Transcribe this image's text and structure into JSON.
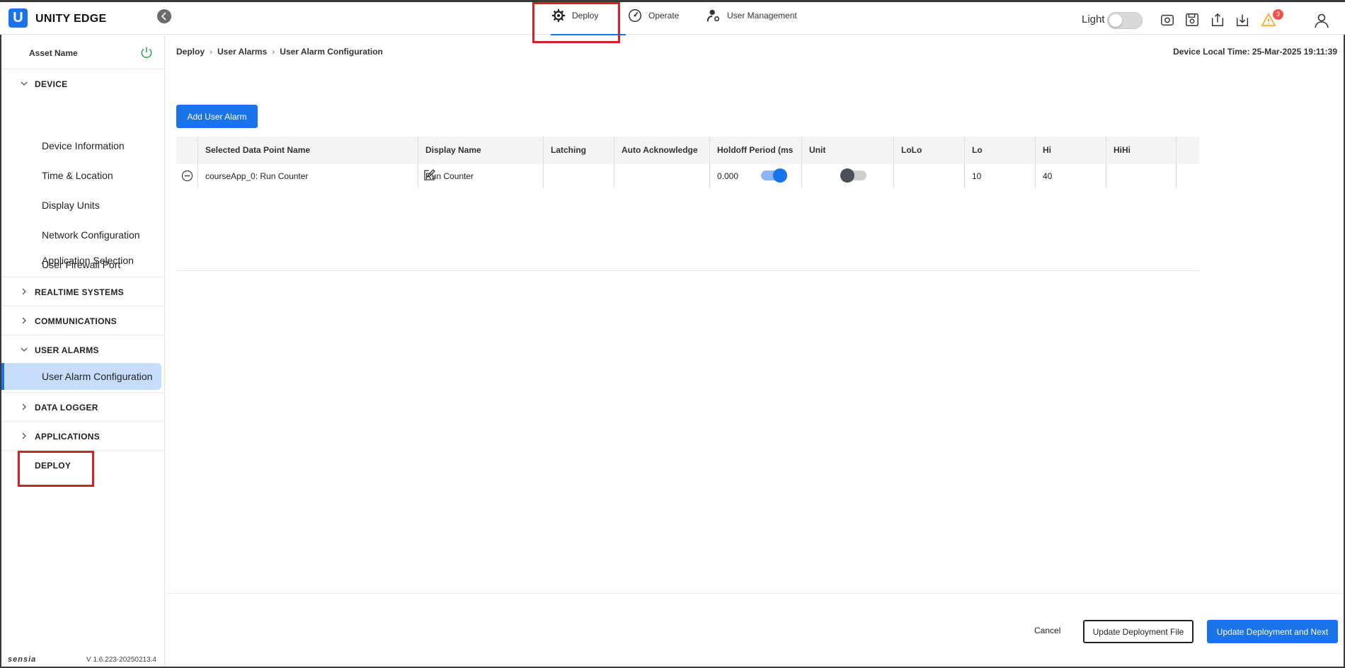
{
  "header": {
    "logo_letter": "U",
    "brand": "UNITY EDGE",
    "tabs": [
      {
        "label": "Deploy",
        "icon": "deploy-gear-icon",
        "active": true
      },
      {
        "label": "Operate",
        "icon": "gauge-icon",
        "active": false
      },
      {
        "label": "User Management",
        "icon": "user-gear-icon",
        "active": false
      }
    ],
    "theme_label": "Light",
    "alert_count": "3",
    "icons": [
      "settings-disk-icon",
      "save-icon",
      "upload-icon",
      "download-icon",
      "warning-icon",
      "user-avatar-icon"
    ]
  },
  "sidebar": {
    "asset_name": "Asset Name",
    "sections": [
      {
        "label": "DEVICE",
        "expanded": true,
        "items": [
          "Device Information",
          "Time & Location",
          "Display Units",
          "Network Configuration",
          "User Firewall Port",
          "Application Selection"
        ]
      },
      {
        "label": "REALTIME SYSTEMS",
        "expanded": false
      },
      {
        "label": "COMMUNICATIONS",
        "expanded": false
      },
      {
        "label": "USER ALARMS",
        "expanded": true,
        "items": [
          "User Alarm Configuration"
        ]
      },
      {
        "label": "DATA LOGGER",
        "expanded": false
      },
      {
        "label": "APPLICATIONS",
        "expanded": false
      },
      {
        "label": "DEPLOY",
        "expanded": false
      }
    ],
    "brand_footer": "sensia",
    "version": "V 1.6.223-20250213.4"
  },
  "breadcrumb": [
    "Deploy",
    "User Alarms",
    "User Alarm Configuration"
  ],
  "device_time": "Device Local Time: 25-Mar-2025 19:11:39",
  "add_button": "Add User Alarm",
  "table": {
    "columns": [
      "Selected Data Point Name",
      "Display Name",
      "Latching",
      "Auto Acknowledge",
      "Holdoff Period (ms",
      "Unit",
      "LoLo",
      "Lo",
      "Hi",
      "HiHi"
    ],
    "rows": [
      {
        "data_point": "courseApp_0: Run Counter",
        "display_name": "Run Counter",
        "latching": true,
        "auto_ack": false,
        "holdoff": "0.000",
        "unit": "",
        "lolo": "",
        "lo": "10",
        "hi": "40",
        "hihi": ""
      }
    ]
  },
  "footer": {
    "cancel": "Cancel",
    "update_file": "Update Deployment File",
    "update_next": "Update Deployment and Next"
  }
}
